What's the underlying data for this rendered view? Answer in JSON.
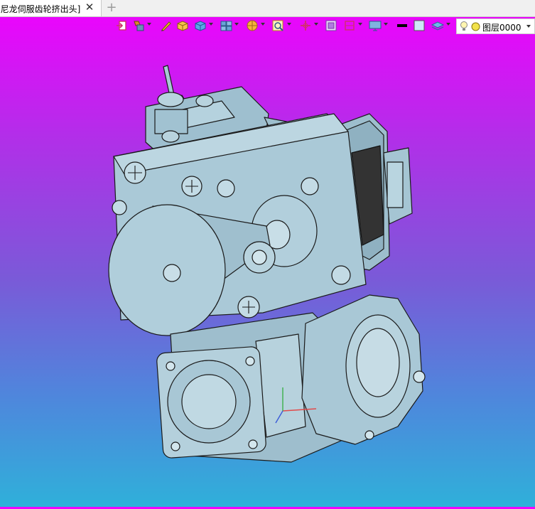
{
  "tab": {
    "title": "]尼龙伺服齿轮挤出头]",
    "close_glyph": "✕",
    "add_glyph": "+"
  },
  "toolbar": {
    "icons": [
      "export-icon",
      "paint-icon",
      "pen-icon",
      "box-solid-icon",
      "cube-view-icon",
      "multi-view-icon",
      "section-icon",
      "zoom-icon",
      "move-icon",
      "window-icon",
      "dimension-icon",
      "display-icon",
      "line-color-icon",
      "color-fill-icon",
      "layer-stack-icon"
    ],
    "layer": {
      "icons": [
        "bulb-icon",
        "layer-color-dot-icon"
      ],
      "value": "图层0000"
    }
  },
  "colors": {
    "gradient_top": "#f200ff",
    "gradient_bottom": "#2fb0da",
    "model_body": "#a9c8d6",
    "model_edge": "#1a1a1a"
  }
}
